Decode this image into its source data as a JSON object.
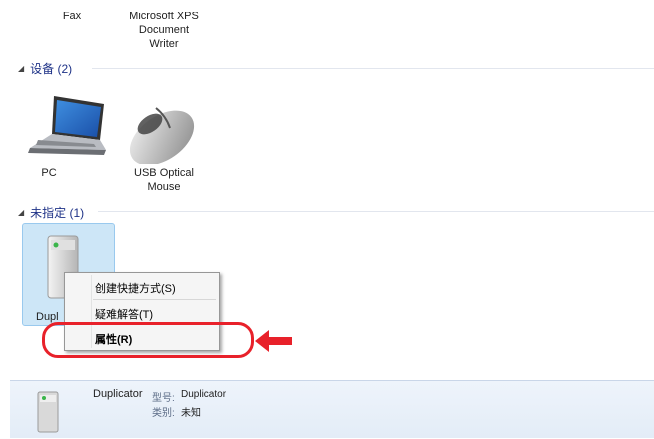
{
  "printers_row": {
    "fax_label": "Fax",
    "xps_label_line1": "Microsoft XPS",
    "xps_label_line2": "Document",
    "xps_label_line3": "Writer"
  },
  "devices_group": {
    "title": "设备 (2)",
    "items": [
      {
        "label": "PC"
      },
      {
        "label_line1": "USB Optical",
        "label_line2": "Mouse"
      }
    ]
  },
  "unspecified_group": {
    "title": "未指定 (1)",
    "items": [
      {
        "label": "Dupl"
      }
    ]
  },
  "context_menu": {
    "items": [
      {
        "label": "创建快捷方式(S)"
      },
      {
        "label": "疑难解答(T)"
      },
      {
        "label": "属性(R)"
      }
    ]
  },
  "details": {
    "device_name": "Duplicator",
    "model_key": "型号:",
    "model_value": "Duplicator",
    "category_key": "类别:",
    "category_value": "未知"
  },
  "colors": {
    "accent": "#1e3287",
    "selection": "#cde6f7",
    "annotation": "#e8212a"
  },
  "icons": [
    "laptop-icon",
    "mouse-icon",
    "printer-device-icon",
    "arrow-left-icon"
  ]
}
